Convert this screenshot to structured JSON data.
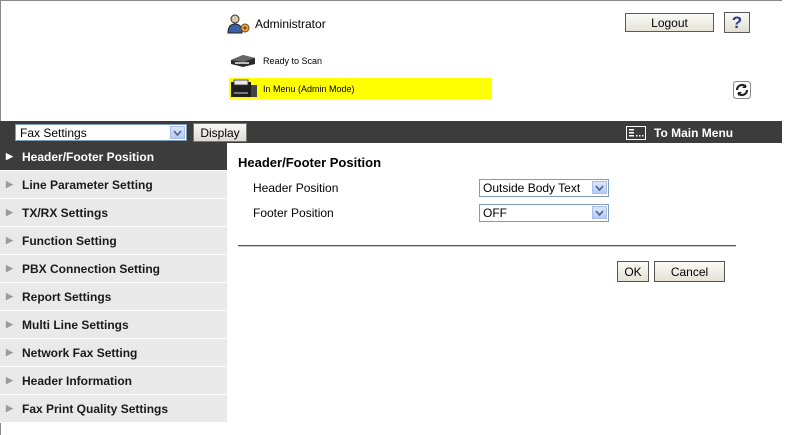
{
  "header": {
    "user_name": "Administrator",
    "logout_label": "Logout",
    "help_label": "?"
  },
  "status": {
    "line1": "Ready to Scan",
    "line2": "In Menu (Admin Mode)",
    "highlight_color": "#ffff00"
  },
  "toolbar": {
    "category_select": "Fax Settings",
    "display_label": "Display",
    "main_menu_label": "To Main Menu"
  },
  "sidebar": {
    "items": [
      {
        "label": "Header/Footer Position",
        "active": true
      },
      {
        "label": "Line Parameter Setting",
        "active": false
      },
      {
        "label": "TX/RX Settings",
        "active": false
      },
      {
        "label": "Function Setting",
        "active": false
      },
      {
        "label": "PBX Connection Setting",
        "active": false
      },
      {
        "label": "Report Settings",
        "active": false
      },
      {
        "label": "Multi Line Settings",
        "active": false
      },
      {
        "label": "Network Fax Setting",
        "active": false
      },
      {
        "label": "Header Information",
        "active": false
      },
      {
        "label": "Fax Print Quality Settings",
        "active": false
      }
    ]
  },
  "main": {
    "title": "Header/Footer Position",
    "fields": [
      {
        "label": "Header Position",
        "value": "Outside Body Text"
      },
      {
        "label": "Footer Position",
        "value": "OFF"
      }
    ],
    "ok_label": "OK",
    "cancel_label": "Cancel"
  },
  "colors": {
    "toolbar_bg": "#3c3c3c",
    "sidebar_bg": "#e9e9e9",
    "sidebar_active_bg": "#3c3c3c"
  }
}
